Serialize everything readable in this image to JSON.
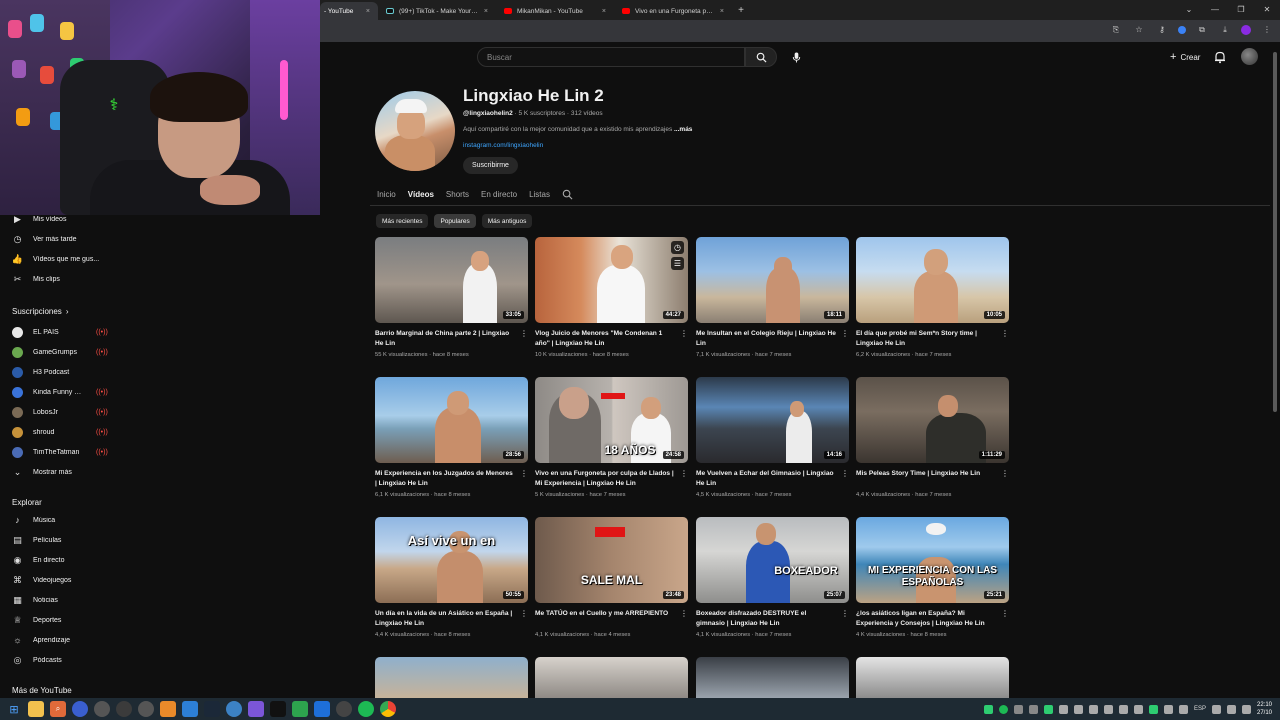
{
  "browser": {
    "tabs": [
      {
        "label": "- YouTube",
        "icon": "youtube-icon",
        "active": true
      },
      {
        "label": "(99+) TikTok - Make Your Day",
        "icon": "tiktok-icon",
        "active": false
      },
      {
        "label": "MikanMikan - YouTube",
        "icon": "youtube-icon",
        "active": false
      },
      {
        "label": "Vivo en una Furgoneta por culpa",
        "icon": "youtube-icon",
        "active": false
      }
    ],
    "new_tab": "+",
    "close_glyph": "×"
  },
  "header": {
    "search_placeholder": "Buscar",
    "create_label": "Crear"
  },
  "sidebar": {
    "library": [
      {
        "label": "Mis vídeos",
        "icon": "play-square-icon"
      },
      {
        "label": "Ver más tarde",
        "icon": "clock-icon"
      },
      {
        "label": "Vídeos que me gus...",
        "icon": "thumbs-up-icon"
      },
      {
        "label": "Mis clips",
        "icon": "scissors-icon"
      }
    ],
    "subscriptions_title": "Suscripciones",
    "subscriptions": [
      {
        "label": "EL PAÍS",
        "color": "#e8e8e8"
      },
      {
        "label": "GameGrumps",
        "color": "#6aa84f"
      },
      {
        "label": "H3 Podcast",
        "color": "#2b5ba8"
      },
      {
        "label": "Kinda Funny Ga...",
        "color": "#3a73d9"
      },
      {
        "label": "LobosJr",
        "color": "#7a6a55"
      },
      {
        "label": "shroud",
        "color": "#c6923a"
      },
      {
        "label": "TimTheTatman",
        "color": "#4a6bb5"
      }
    ],
    "show_more": "Mostrar más",
    "explore_title": "Explorar",
    "explore": [
      {
        "label": "Música",
        "icon": "music-icon"
      },
      {
        "label": "Películas",
        "icon": "film-icon"
      },
      {
        "label": "En directo",
        "icon": "live-icon"
      },
      {
        "label": "Videojuegos",
        "icon": "gamepad-icon"
      },
      {
        "label": "Noticias",
        "icon": "news-icon"
      },
      {
        "label": "Deportes",
        "icon": "trophy-icon"
      },
      {
        "label": "Aprendizaje",
        "icon": "bulb-icon"
      },
      {
        "label": "Pódcasts",
        "icon": "podcast-icon"
      }
    ],
    "more_title": "Más de YouTube"
  },
  "channel": {
    "name": "Lingxiao He Lin 2",
    "handle": "@lingxiaohelin2",
    "meta_rest": " · 5 K suscriptores · 312 vídeos",
    "description": "Aquí compartiré con la mejor comunidad que a existido mis aprendizajes ",
    "description_more": "...más",
    "link": "instagram.com/lingxiaohelin",
    "subscribe_label": "Suscribirme",
    "tabs": [
      "Inicio",
      "Vídeos",
      "Shorts",
      "En directo",
      "Listas"
    ],
    "active_tab": "Vídeos",
    "chips": [
      "Más recientes",
      "Populares",
      "Más antiguos"
    ]
  },
  "videos": [
    {
      "title": "Barrio Marginal de China parte 2 | Lingxiao He Lin",
      "meta": "55 K visualizaciones · hace 8 meses",
      "duration": "33:05",
      "overlay": ""
    },
    {
      "title": "Vlog Juicio de Menores \"Me Condenan 1 año\" | Lingxiao He Lin",
      "meta": "10 K visualizaciones · hace 8 meses",
      "duration": "44:27",
      "overlay": ""
    },
    {
      "title": "Me Insultan en el Colegio Rieju | Lingxiao He Lin",
      "meta": "7,1 K visualizaciones · hace 7 meses",
      "duration": "18:11",
      "overlay": ""
    },
    {
      "title": "El día que probé mi Sem*n Story time | Lingxiao He Lin",
      "meta": "6,2 K visualizaciones · hace 7 meses",
      "duration": "10:05",
      "overlay": ""
    },
    {
      "title": "Mi Experiencia en los Juzgados de Menores | Lingxiao He Lin",
      "meta": "6,1 K visualizaciones · hace 8 meses",
      "duration": "28:56",
      "overlay": ""
    },
    {
      "title": "Vivo en una Furgoneta por culpa de Llados | Mi Experiencia | Lingxiao He Lin",
      "meta": "5 K visualizaciones · hace 7 meses",
      "duration": "24:58",
      "overlay": "18 AÑOS"
    },
    {
      "title": "Me Vuelven a Echar del Gimnasio | Lingxiao He Lin",
      "meta": "4,5 K visualizaciones · hace 7 meses",
      "duration": "14:16",
      "overlay": ""
    },
    {
      "title": "Mis Peleas Story Time | Lingxiao He Lin",
      "meta": "4,4 K visualizaciones · hace 7 meses",
      "duration": "1:11:29",
      "overlay": ""
    },
    {
      "title": "Un día en la vida de un Asiático en España | Lingxiao He Lin",
      "meta": "4,4 K visualizaciones · hace 8 meses",
      "duration": "50:55",
      "overlay": "Así vive un    en"
    },
    {
      "title": "Me TATÚO en el Cuello y me ARREPIENTO",
      "meta": "4,1 K visualizaciones · hace 4 meses",
      "duration": "23:48",
      "overlay": "SALE MAL"
    },
    {
      "title": "Boxeador disfrazado DESTRUYE el gimnasio | Lingxiao He Lin",
      "meta": "4,1 K visualizaciones · hace 7 meses",
      "duration": "25:07",
      "overlay": "BOXEADOR"
    },
    {
      "title": "¿los asiáticos ligan en España? Mi Experiencia y Consejos | Lingxiao He Lin",
      "meta": "4 K visualizaciones · hace 8 meses",
      "duration": "25:21",
      "overlay": "MI EXPERIENCIA CON LAS ESPAÑOLAS"
    }
  ],
  "taskbar": {
    "lang": "ESP",
    "time": "22:10",
    "date": "27/10"
  }
}
